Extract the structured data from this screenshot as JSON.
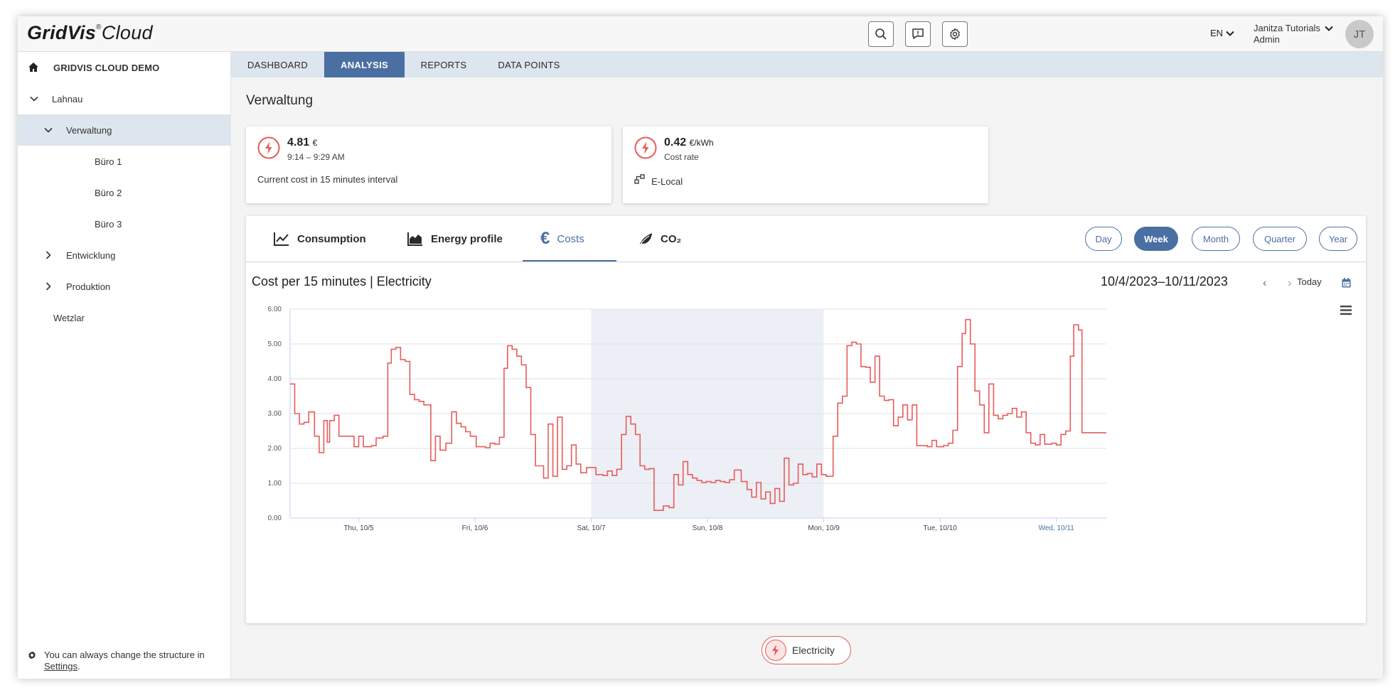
{
  "app": {
    "logo_main": "GridVis",
    "logo_reg": "®",
    "logo_suffix": "Cloud",
    "language": "EN",
    "user_name": "Janitza Tutorials",
    "user_role": "Admin",
    "avatar_initials": "JT"
  },
  "sidebar": {
    "root_label": "GRIDVIS CLOUD DEMO",
    "items": [
      {
        "label": "Lahnau",
        "level": 0,
        "expanded": true,
        "has_children": true,
        "active": false
      },
      {
        "label": "Verwaltung",
        "level": 1,
        "expanded": true,
        "has_children": true,
        "active": true
      },
      {
        "label": "Büro 1",
        "level": 2,
        "has_children": false,
        "active": false
      },
      {
        "label": "Büro 2",
        "level": 2,
        "has_children": false,
        "active": false
      },
      {
        "label": "Büro 3",
        "level": 2,
        "has_children": false,
        "active": false
      },
      {
        "label": "Entwicklung",
        "level": 1,
        "expanded": false,
        "has_children": true,
        "active": false
      },
      {
        "label": "Produktion",
        "level": 1,
        "expanded": false,
        "has_children": true,
        "active": false
      },
      {
        "label": "Wetzlar",
        "level": 0,
        "has_children": false,
        "active": false
      }
    ],
    "footer_text": "You can always change the structure in",
    "footer_link": "Settings",
    "footer_end": "."
  },
  "topnav": {
    "tabs": [
      "DASHBOARD",
      "ANALYSIS",
      "REPORTS",
      "DATA POINTS"
    ],
    "active": "ANALYSIS"
  },
  "page": {
    "title": "Verwaltung"
  },
  "kpi": {
    "current": {
      "value": "4.81",
      "unit": "€",
      "time": "9:14 – 9:29 AM",
      "description": "Current cost in 15 minutes interval"
    },
    "rate": {
      "value": "0.42",
      "unit": "€/kWh",
      "label": "Cost rate",
      "tariff": "E-Local"
    }
  },
  "chart_tabs": {
    "tabs": [
      "Consumption",
      "Energy profile",
      "Costs",
      "CO₂"
    ],
    "active": "Costs"
  },
  "periods": {
    "options": [
      "Day",
      "Week",
      "Month",
      "Quarter",
      "Year"
    ],
    "active": "Week"
  },
  "chart_header": {
    "title": "Cost per 15 minutes | Electricity",
    "date_range": "10/4/2023–10/11/2023",
    "prev": "‹",
    "next": "›",
    "today": "Today"
  },
  "colors": {
    "accent": "#4a70a3",
    "series": "#e85b5b",
    "weekend_band": "#eceff5"
  },
  "legend": {
    "label": "Electricity"
  },
  "chart_data": {
    "type": "line",
    "step": true,
    "ylabel": "€",
    "ylim": [
      0,
      6
    ],
    "yticks": [
      "0.00",
      "1.00",
      "2.00",
      "3.00",
      "4.00",
      "5.00",
      "6.00"
    ],
    "xlim": [
      0,
      7.02
    ],
    "xticks": [
      {
        "x": 0.59,
        "label": "Thu, 10/5"
      },
      {
        "x": 1.59,
        "label": "Fri, 10/6"
      },
      {
        "x": 2.59,
        "label": "Sat, 10/7"
      },
      {
        "x": 3.59,
        "label": "Sun, 10/8"
      },
      {
        "x": 4.59,
        "label": "Mon, 10/9"
      },
      {
        "x": 5.59,
        "label": "Tue, 10/10"
      },
      {
        "x": 6.59,
        "label": "Wed, 10/11"
      }
    ],
    "weekend_band": [
      2.59,
      4.59
    ],
    "grid": true,
    "series": [
      {
        "name": "Electricity",
        "points": [
          [
            0.0,
            3.85
          ],
          [
            0.04,
            3.0
          ],
          [
            0.08,
            2.7
          ],
          [
            0.12,
            2.75
          ],
          [
            0.16,
            3.05
          ],
          [
            0.21,
            2.35
          ],
          [
            0.25,
            1.88
          ],
          [
            0.29,
            2.8
          ],
          [
            0.32,
            2.18
          ],
          [
            0.34,
            2.8
          ],
          [
            0.38,
            2.95
          ],
          [
            0.42,
            2.35
          ],
          [
            0.48,
            2.35
          ],
          [
            0.55,
            2.05
          ],
          [
            0.59,
            2.35
          ],
          [
            0.63,
            2.05
          ],
          [
            0.7,
            2.08
          ],
          [
            0.74,
            2.3
          ],
          [
            0.8,
            2.35
          ],
          [
            0.84,
            4.45
          ],
          [
            0.87,
            4.85
          ],
          [
            0.91,
            4.9
          ],
          [
            0.95,
            4.55
          ],
          [
            0.99,
            4.5
          ],
          [
            1.03,
            3.55
          ],
          [
            1.07,
            3.4
          ],
          [
            1.11,
            3.35
          ],
          [
            1.15,
            3.25
          ],
          [
            1.21,
            1.65
          ],
          [
            1.25,
            2.35
          ],
          [
            1.29,
            1.95
          ],
          [
            1.34,
            2.15
          ],
          [
            1.39,
            3.05
          ],
          [
            1.43,
            2.72
          ],
          [
            1.47,
            2.62
          ],
          [
            1.51,
            2.48
          ],
          [
            1.55,
            2.35
          ],
          [
            1.6,
            2.05
          ],
          [
            1.68,
            2.02
          ],
          [
            1.72,
            2.15
          ],
          [
            1.76,
            2.12
          ],
          [
            1.8,
            2.32
          ],
          [
            1.84,
            4.3
          ],
          [
            1.87,
            4.95
          ],
          [
            1.91,
            4.85
          ],
          [
            1.95,
            4.65
          ],
          [
            1.99,
            4.4
          ],
          [
            2.03,
            3.75
          ],
          [
            2.07,
            2.4
          ],
          [
            2.11,
            1.5
          ],
          [
            2.18,
            1.15
          ],
          [
            2.22,
            2.7
          ],
          [
            2.26,
            1.2
          ],
          [
            2.3,
            2.9
          ],
          [
            2.34,
            1.4
          ],
          [
            2.38,
            1.5
          ],
          [
            2.42,
            2.1
          ],
          [
            2.46,
            1.55
          ],
          [
            2.5,
            1.3
          ],
          [
            2.55,
            1.45
          ],
          [
            2.63,
            1.25
          ],
          [
            2.69,
            1.22
          ],
          [
            2.73,
            1.35
          ],
          [
            2.77,
            1.22
          ],
          [
            2.81,
            1.4
          ],
          [
            2.85,
            2.4
          ],
          [
            2.89,
            2.92
          ],
          [
            2.93,
            2.7
          ],
          [
            2.97,
            2.4
          ],
          [
            3.01,
            1.5
          ],
          [
            3.05,
            1.4
          ],
          [
            3.09,
            1.42
          ],
          [
            3.13,
            0.22
          ],
          [
            3.21,
            0.35
          ],
          [
            3.26,
            0.3
          ],
          [
            3.3,
            1.25
          ],
          [
            3.34,
            0.95
          ],
          [
            3.38,
            1.62
          ],
          [
            3.42,
            1.25
          ],
          [
            3.46,
            1.15
          ],
          [
            3.5,
            1.08
          ],
          [
            3.54,
            1.02
          ],
          [
            3.58,
            1.05
          ],
          [
            3.62,
            1.02
          ],
          [
            3.66,
            1.08
          ],
          [
            3.7,
            1.05
          ],
          [
            3.74,
            1.02
          ],
          [
            3.78,
            1.1
          ],
          [
            3.82,
            1.38
          ],
          [
            3.88,
            1.05
          ],
          [
            3.93,
            0.82
          ],
          [
            3.97,
            0.6
          ],
          [
            4.01,
            1.02
          ],
          [
            4.05,
            0.55
          ],
          [
            4.09,
            0.75
          ],
          [
            4.13,
            0.42
          ],
          [
            4.17,
            0.85
          ],
          [
            4.21,
            0.48
          ],
          [
            4.25,
            1.72
          ],
          [
            4.29,
            0.95
          ],
          [
            4.33,
            1.0
          ],
          [
            4.37,
            1.55
          ],
          [
            4.41,
            1.25
          ],
          [
            4.45,
            1.28
          ],
          [
            4.49,
            1.18
          ],
          [
            4.53,
            1.55
          ],
          [
            4.57,
            1.25
          ],
          [
            4.61,
            1.2
          ],
          [
            4.67,
            2.35
          ],
          [
            4.71,
            3.3
          ],
          [
            4.75,
            3.5
          ],
          [
            4.79,
            4.95
          ],
          [
            4.83,
            5.05
          ],
          [
            4.87,
            5.0
          ],
          [
            4.91,
            4.35
          ],
          [
            4.95,
            4.33
          ],
          [
            4.99,
            3.9
          ],
          [
            5.03,
            4.65
          ],
          [
            5.07,
            3.5
          ],
          [
            5.11,
            3.38
          ],
          [
            5.15,
            3.4
          ],
          [
            5.19,
            2.65
          ],
          [
            5.23,
            2.9
          ],
          [
            5.27,
            3.25
          ],
          [
            5.31,
            2.82
          ],
          [
            5.35,
            3.25
          ],
          [
            5.39,
            2.08
          ],
          [
            5.48,
            2.05
          ],
          [
            5.52,
            2.23
          ],
          [
            5.56,
            2.05
          ],
          [
            5.62,
            2.08
          ],
          [
            5.66,
            2.15
          ],
          [
            5.7,
            2.52
          ],
          [
            5.74,
            4.35
          ],
          [
            5.78,
            5.3
          ],
          [
            5.81,
            5.7
          ],
          [
            5.85,
            5.0
          ],
          [
            5.89,
            3.65
          ],
          [
            5.93,
            3.25
          ],
          [
            5.97,
            2.45
          ],
          [
            6.01,
            3.85
          ],
          [
            6.05,
            2.95
          ],
          [
            6.09,
            2.85
          ],
          [
            6.13,
            2.95
          ],
          [
            6.17,
            3.0
          ],
          [
            6.21,
            3.15
          ],
          [
            6.25,
            2.9
          ],
          [
            6.29,
            3.05
          ],
          [
            6.33,
            2.45
          ],
          [
            6.37,
            2.15
          ],
          [
            6.41,
            2.1
          ],
          [
            6.45,
            2.4
          ],
          [
            6.49,
            2.12
          ],
          [
            6.55,
            2.15
          ],
          [
            6.59,
            2.1
          ],
          [
            6.63,
            2.4
          ],
          [
            6.67,
            2.5
          ],
          [
            6.71,
            4.65
          ],
          [
            6.74,
            5.55
          ],
          [
            6.78,
            5.4
          ],
          [
            6.81,
            2.45
          ],
          [
            7.02,
            2.45
          ]
        ]
      }
    ]
  }
}
